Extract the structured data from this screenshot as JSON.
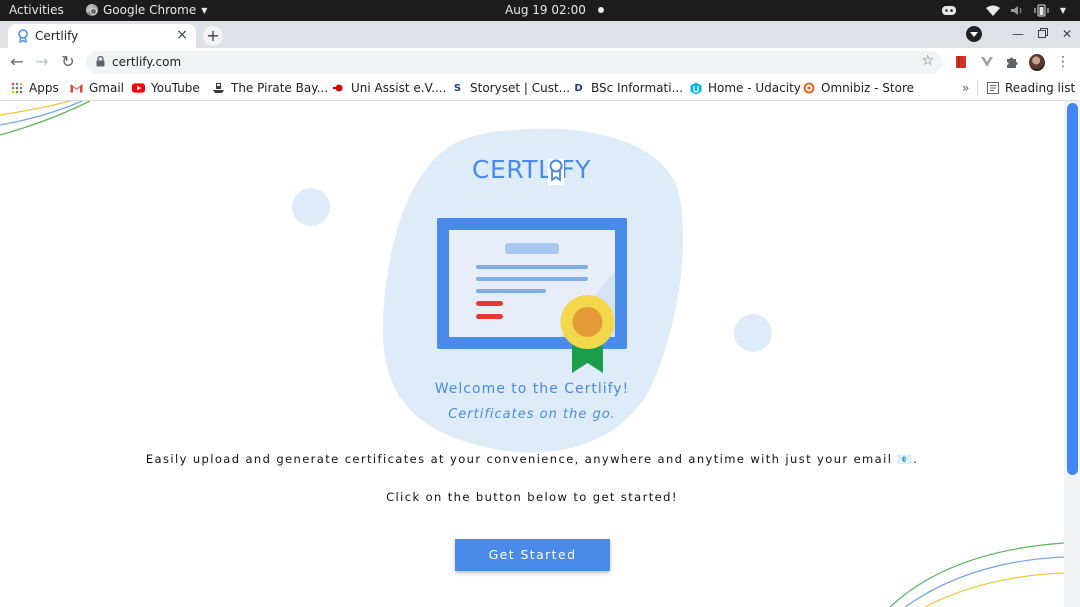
{
  "system_bar": {
    "activities": "Activities",
    "app_name": "Google Chrome",
    "clock": "Aug 19  02:00"
  },
  "browser": {
    "tab_title": "Certlify",
    "url": "certlify.com",
    "bookmarks": [
      {
        "label": "Apps",
        "icon": "apps-grid-icon"
      },
      {
        "label": "Gmail",
        "icon": "gmail-icon"
      },
      {
        "label": "YouTube",
        "icon": "youtube-icon"
      },
      {
        "label": "The Pirate Bay...",
        "icon": "pirate-ship-icon"
      },
      {
        "label": "Uni Assist e.V....",
        "icon": "uni-assist-icon"
      },
      {
        "label": "Storyset | Cust...",
        "icon": "storyset-icon"
      },
      {
        "label": "BSc Informati...",
        "icon": "d-letter-icon"
      },
      {
        "label": "Home - Udacity",
        "icon": "udacity-icon"
      },
      {
        "label": "Omnibiz - Store",
        "icon": "omnibiz-icon"
      }
    ],
    "reading_list": "Reading list",
    "overflow": "»"
  },
  "page": {
    "logo_text": "CERTLIFY",
    "welcome": "Welcome to the Certlify!",
    "tagline": "Certificates on the go.",
    "description": "Easily upload and generate certificates at your convenience, anywhere and anytime with just your email 📧.",
    "cta_text": "Click on the button below to get started!",
    "button_label": "Get Started"
  },
  "colors": {
    "brand_blue": "#4a8ae8",
    "blob": "#deecf9",
    "ribbon_green": "#1b9e4b",
    "medal_gold": "#f2d84a",
    "red_line": "#e53935"
  }
}
